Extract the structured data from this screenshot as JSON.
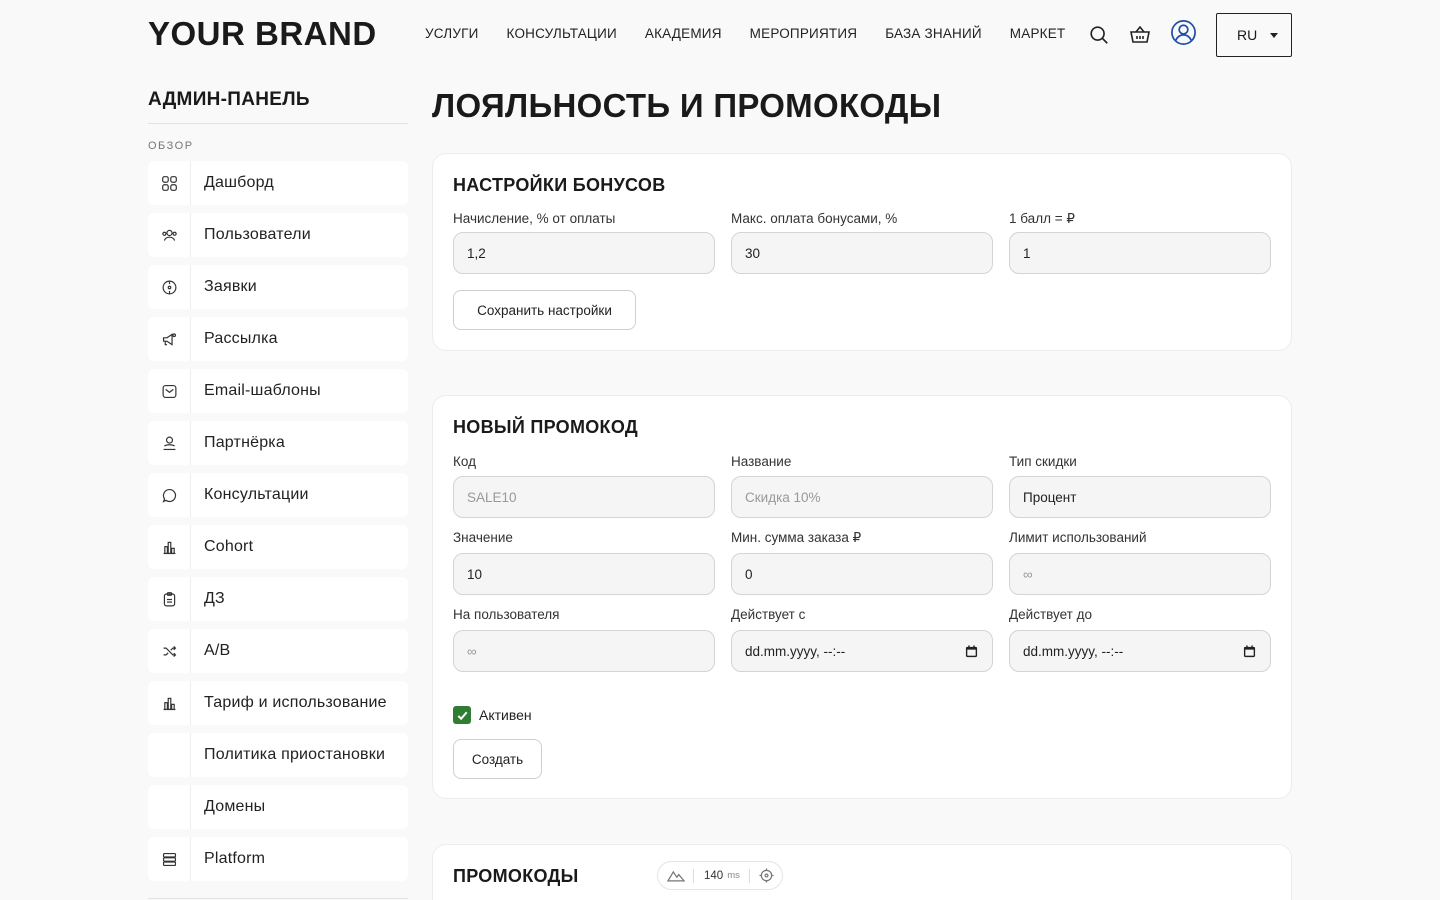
{
  "header": {
    "brand": "YOUR BRAND",
    "nav": [
      "УСЛУГИ",
      "КОНСУЛЬТАЦИИ",
      "АКАДЕМИЯ",
      "МЕРОПРИЯТИЯ",
      "БАЗА ЗНАНИЙ",
      "МАРКЕТ"
    ],
    "lang": "RU",
    "icons": [
      "search-icon",
      "cart-icon",
      "user-icon"
    ]
  },
  "sidebar": {
    "title": "АДМИН-ПАНЕЛЬ",
    "section": "ОБЗОР",
    "items": [
      {
        "label": "Дашборд",
        "icon": "grid-icon"
      },
      {
        "label": "Пользователи",
        "icon": "users-icon"
      },
      {
        "label": "Заявки",
        "icon": "target-icon"
      },
      {
        "label": "Рассылка",
        "icon": "megaphone-icon"
      },
      {
        "label": "Email-шаблоны",
        "icon": "mail-icon"
      },
      {
        "label": "Партнёрка",
        "icon": "partner-icon"
      },
      {
        "label": "Консультации",
        "icon": "chat-icon"
      },
      {
        "label": "Cohort",
        "icon": "bar-chart-icon"
      },
      {
        "label": "ДЗ",
        "icon": "clipboard-icon"
      },
      {
        "label": "A/B",
        "icon": "shuffle-icon"
      },
      {
        "label": "Тариф и использование",
        "icon": "bar-chart-icon"
      },
      {
        "label": "Политика приостановки",
        "icon": ""
      },
      {
        "label": "Домены",
        "icon": ""
      },
      {
        "label": "Platform",
        "icon": "server-icon"
      }
    ]
  },
  "main": {
    "title": "ЛОЯЛЬНОСТЬ И ПРОМОКОДЫ",
    "bonus": {
      "title": "НАСТРОЙКИ БОНУСОВ",
      "accrual_label": "Начисление, % от оплаты",
      "accrual_value": "1,2",
      "max_pay_label": "Макс. оплата бонусами, %",
      "max_pay_value": "30",
      "point_label": "1 балл = ₽",
      "point_value": "1",
      "save_label": "Сохранить настройки"
    },
    "promo": {
      "title": "НОВЫЙ ПРОМОКОД",
      "code_label": "Код",
      "code_placeholder": "SALE10",
      "name_label": "Название",
      "name_placeholder": "Скидка 10%",
      "type_label": "Тип скидки",
      "type_value": "Процент",
      "value_label": "Значение",
      "value_value": "10",
      "min_label": "Мин. сумма заказа ₽",
      "min_value": "0",
      "limit_label": "Лимит использований",
      "limit_placeholder": "∞",
      "per_user_label": "На пользователя",
      "per_user_placeholder": "∞",
      "from_label": "Действует с",
      "from_value": "dd.mm.yyyy, --:--",
      "to_label": "Действует до",
      "to_value": "dd.mm.yyyy, --:--",
      "active_label": "Активен",
      "active_checked": true,
      "create_label": "Создать"
    },
    "list": {
      "title": "ПРОМОКОДЫ"
    }
  },
  "perf": {
    "value": "140",
    "unit": "ms"
  },
  "colors": {
    "background": "#f9f9f9",
    "checkbox": "#2e7d32",
    "user_icon": "#1e4fa8"
  }
}
